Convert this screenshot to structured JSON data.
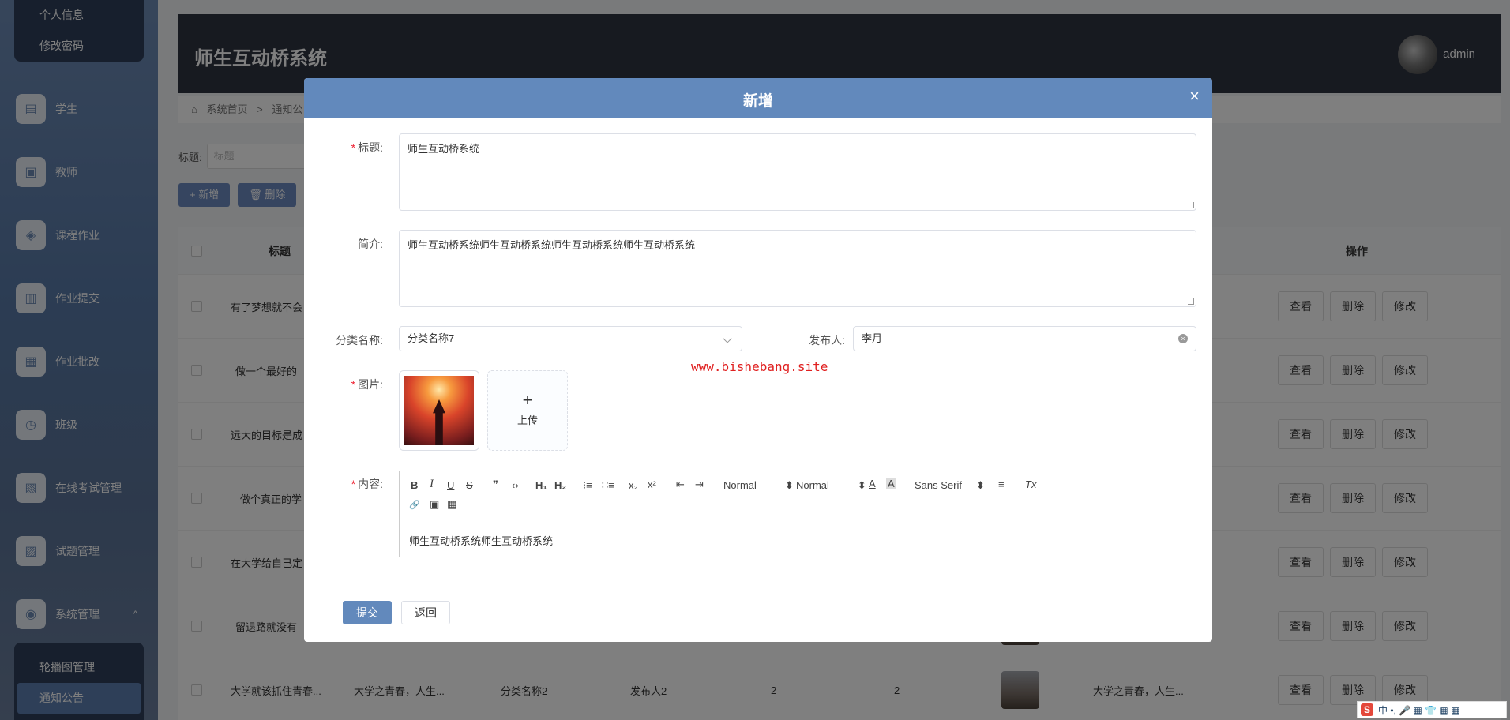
{
  "sidebar": {
    "top_sub": [
      "个人信息",
      "修改密码"
    ],
    "items": [
      {
        "label": "学生",
        "icon": "▤"
      },
      {
        "label": "教师",
        "icon": "▣"
      },
      {
        "label": "课程作业",
        "icon": "◈"
      },
      {
        "label": "作业提交",
        "icon": "▥"
      },
      {
        "label": "作业批改",
        "icon": "▦"
      },
      {
        "label": "班级",
        "icon": "◷"
      },
      {
        "label": "在线考试管理",
        "icon": "▧"
      },
      {
        "label": "试题管理",
        "icon": "▨"
      },
      {
        "label": "系统管理",
        "icon": "◉",
        "caret": "^"
      }
    ],
    "bottom_sub": [
      "轮播图管理",
      "通知公告"
    ]
  },
  "header": {
    "title": "师生互动桥系统",
    "user": "admin"
  },
  "breadcrumb": [
    "系统首页",
    ">",
    "通知公"
  ],
  "search": {
    "label": "标题:",
    "placeholder": "标题"
  },
  "actions": {
    "add": "+ 新增",
    "delete": "删除"
  },
  "table": {
    "headers": {
      "title": "标题",
      "ops": "操作"
    },
    "rows": [
      {
        "title": "有了梦想就不会"
      },
      {
        "title": "做一个最好的"
      },
      {
        "title": "远大的目标是成"
      },
      {
        "title": "做个真正的学"
      },
      {
        "title": "在大学给自己定"
      },
      {
        "title": "留退路就没有"
      },
      {
        "title": "大学就该抓住青春...",
        "intro": "大学之青春，人生...",
        "category": "分类名称2",
        "publisher": "发布人2",
        "c1": "2",
        "c2": "2",
        "content": "大学之青春，人生..."
      }
    ],
    "op_view": "查看",
    "op_delete": "删除",
    "op_edit": "修改"
  },
  "modal": {
    "title": "新增",
    "close": "×",
    "fields": {
      "title_label": "标题:",
      "title_value": "师生互动桥系统",
      "intro_label": "简介:",
      "intro_value": "师生互动桥系统师生互动桥系统师生互动桥系统师生互动桥系统",
      "category_label": "分类名称:",
      "category_value": "分类名称7",
      "publisher_label": "发布人:",
      "publisher_value": "李月",
      "image_label": "图片:",
      "upload_plus": "+",
      "upload_label": "上传",
      "content_label": "内容:",
      "content_value": "师生互动桥系统师生互动桥系统"
    },
    "watermark": "www.bishebang.site",
    "toolbar": {
      "bold": "B",
      "italic": "I",
      "underline": "U",
      "strike": "S",
      "quote": "❞",
      "code": "‹›",
      "h1": "H₁",
      "h2": "H₂",
      "ol": "⁝≡",
      "ul": "∷≡",
      "sub": "x₂",
      "sup": "x²",
      "outdent": "⇤",
      "indent": "⇥",
      "size": "Normal",
      "header": "Normal",
      "font": "Sans Serif",
      "color": "A",
      "bg": "A",
      "align": "≡",
      "clean": "Tx",
      "link": "🔗",
      "image": "▣",
      "video": "▦"
    },
    "submit": "提交",
    "back": "返回"
  },
  "ime": {
    "logo": "S",
    "text": "中 •, 🎤 ▦ 👕 ▦ ▦"
  }
}
